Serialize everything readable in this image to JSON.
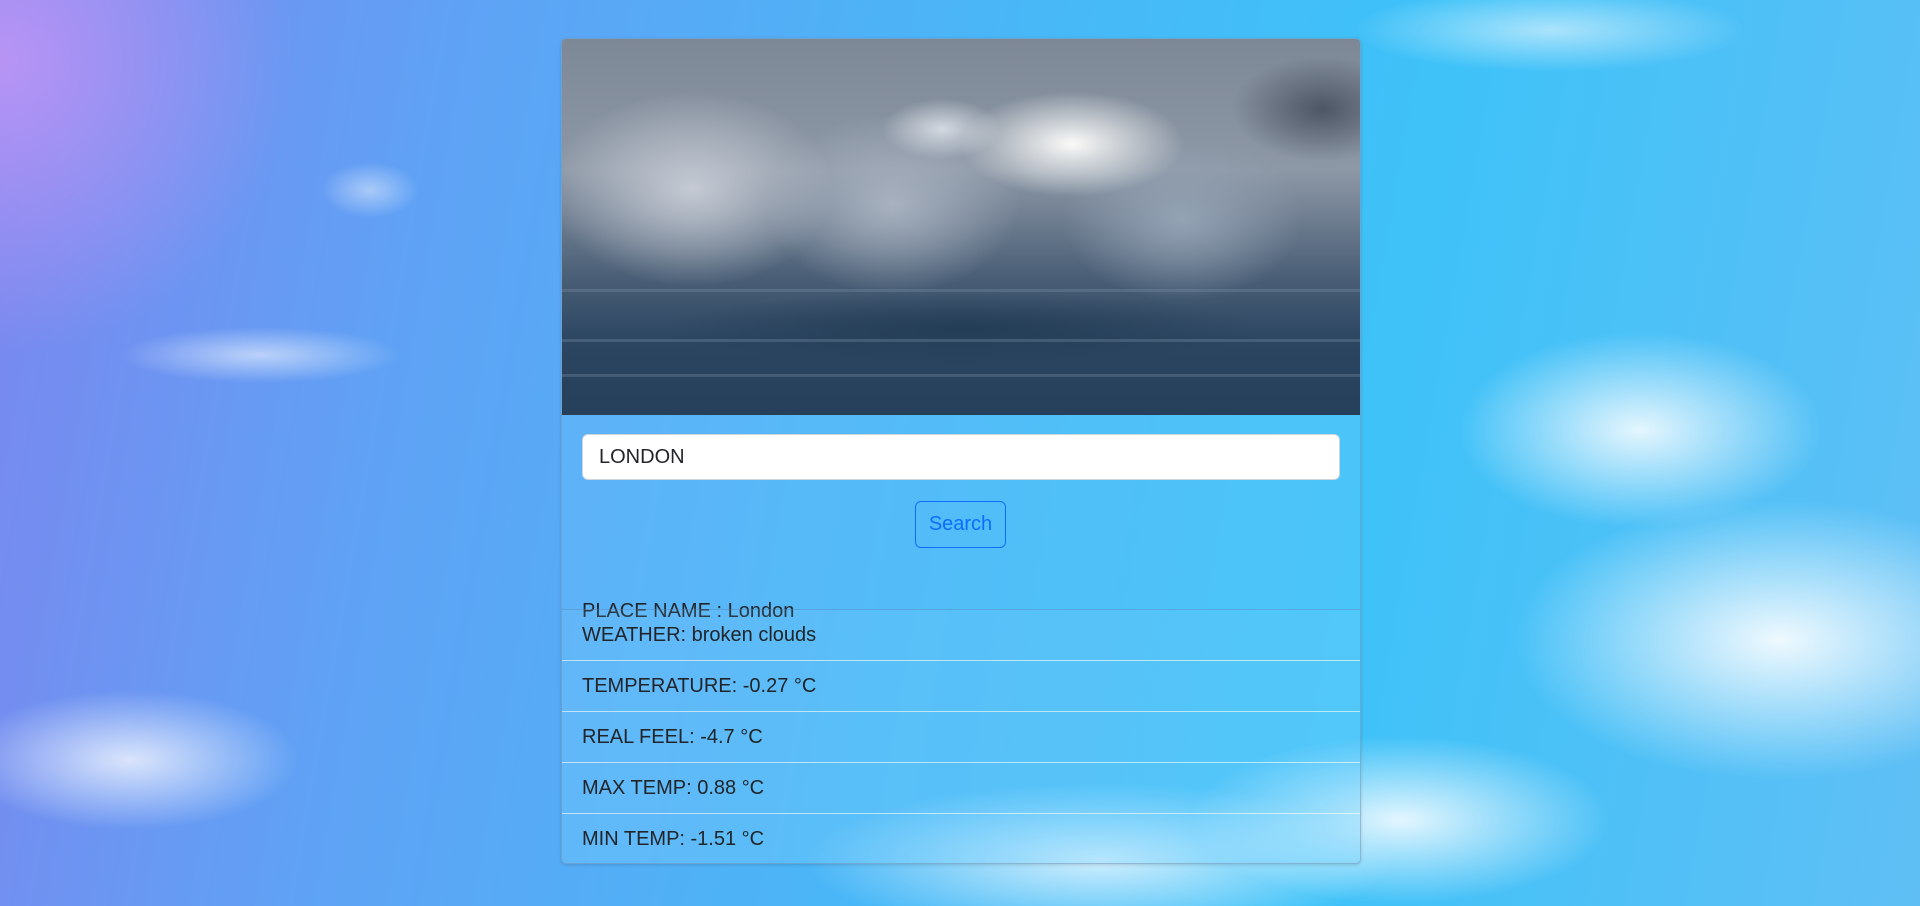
{
  "search": {
    "value": "LONDON",
    "button_label": "Search"
  },
  "place": {
    "label": "PLACE NAME : London"
  },
  "details": [
    {
      "text": "WEATHER: broken clouds"
    },
    {
      "text": "TEMPERATURE: -0.27 °C"
    },
    {
      "text": "REAL FEEL: -4.7 °C"
    },
    {
      "text": "MAX TEMP: 0.88 °C"
    },
    {
      "text": "MIN TEMP: -1.51 °C"
    }
  ],
  "colors": {
    "accent": "#0d6efd",
    "text": "#212529"
  }
}
